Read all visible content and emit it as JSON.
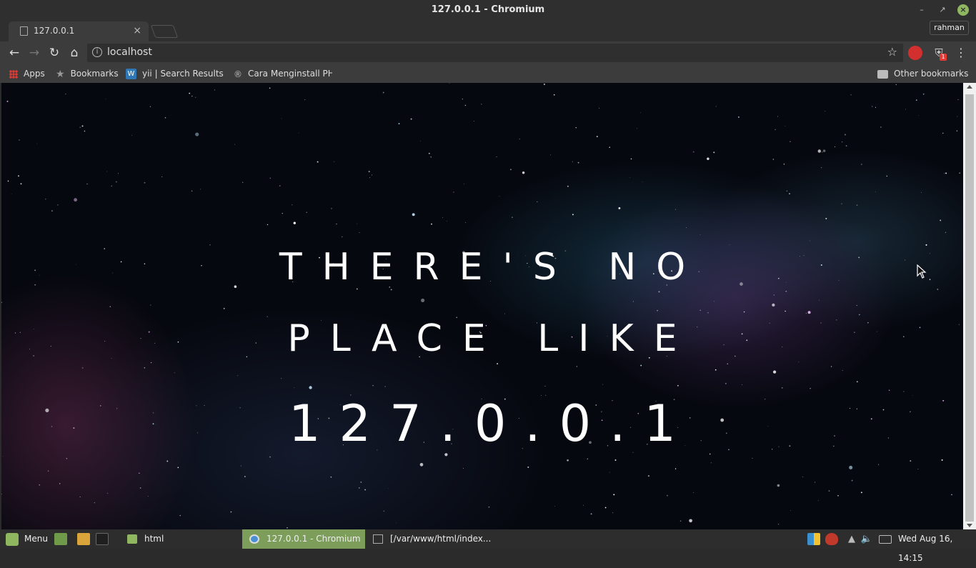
{
  "window": {
    "title": "127.0.0.1 - Chromium"
  },
  "browser": {
    "tab": {
      "title": "127.0.0.1"
    },
    "profile": "rahman",
    "omnibox": {
      "url": "localhost"
    },
    "extensions": {
      "shield_badge": "1"
    },
    "bookmarks": {
      "apps": "Apps",
      "bookmarks": "Bookmarks",
      "yii": "yii | Search Results",
      "cara": "Cara Menginstall PHP",
      "other": "Other bookmarks"
    }
  },
  "page": {
    "line1": "THERE'S NO",
    "line2": "PLACE LIKE",
    "line3": "127.0.0.1"
  },
  "taskbar": {
    "menu": "Menu",
    "windows": {
      "html": "html",
      "chrome": "127.0.0.1 - Chromium",
      "editor": "[/var/www/html/index..."
    },
    "clock": "Wed Aug 16, 14:15"
  },
  "colors": {
    "mint_green": "#8fb760",
    "active_task": "#7c9e5a",
    "space_bg": "#06080f"
  }
}
